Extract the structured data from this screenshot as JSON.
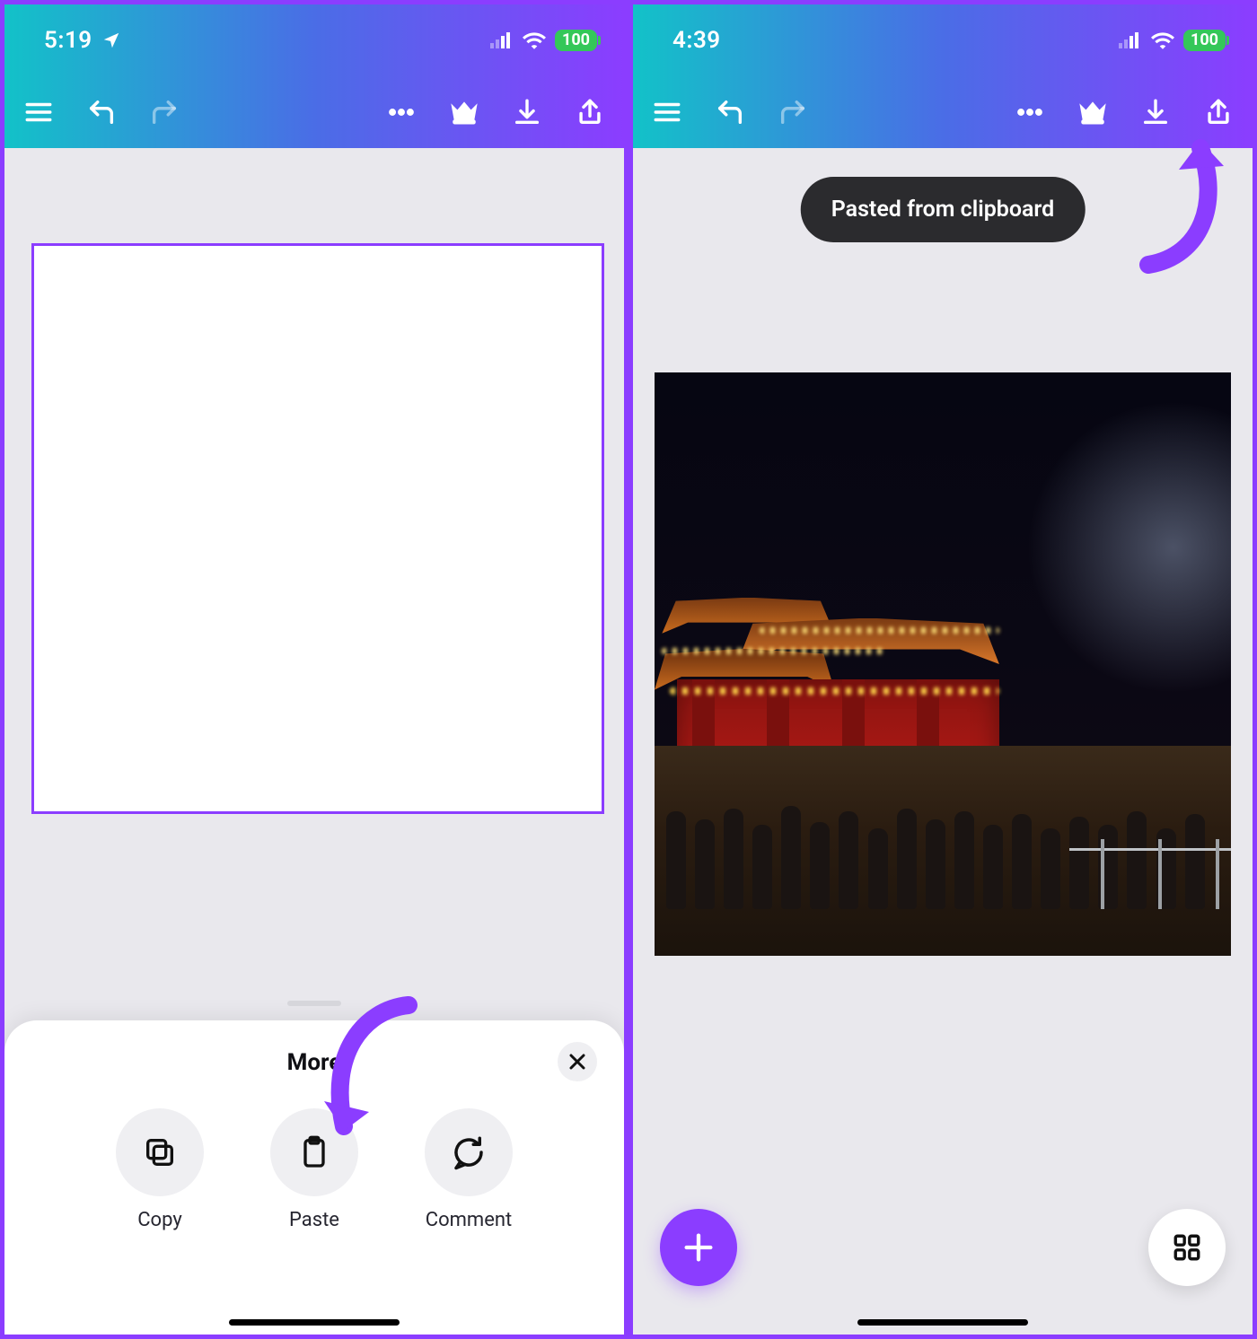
{
  "left": {
    "status": {
      "time": "5:19",
      "battery": "100"
    },
    "sheet": {
      "title": "More",
      "actions": [
        {
          "label": "Copy"
        },
        {
          "label": "Paste"
        },
        {
          "label": "Comment"
        }
      ]
    }
  },
  "right": {
    "status": {
      "time": "4:39",
      "battery": "100"
    },
    "toast": "Pasted from clipboard"
  }
}
